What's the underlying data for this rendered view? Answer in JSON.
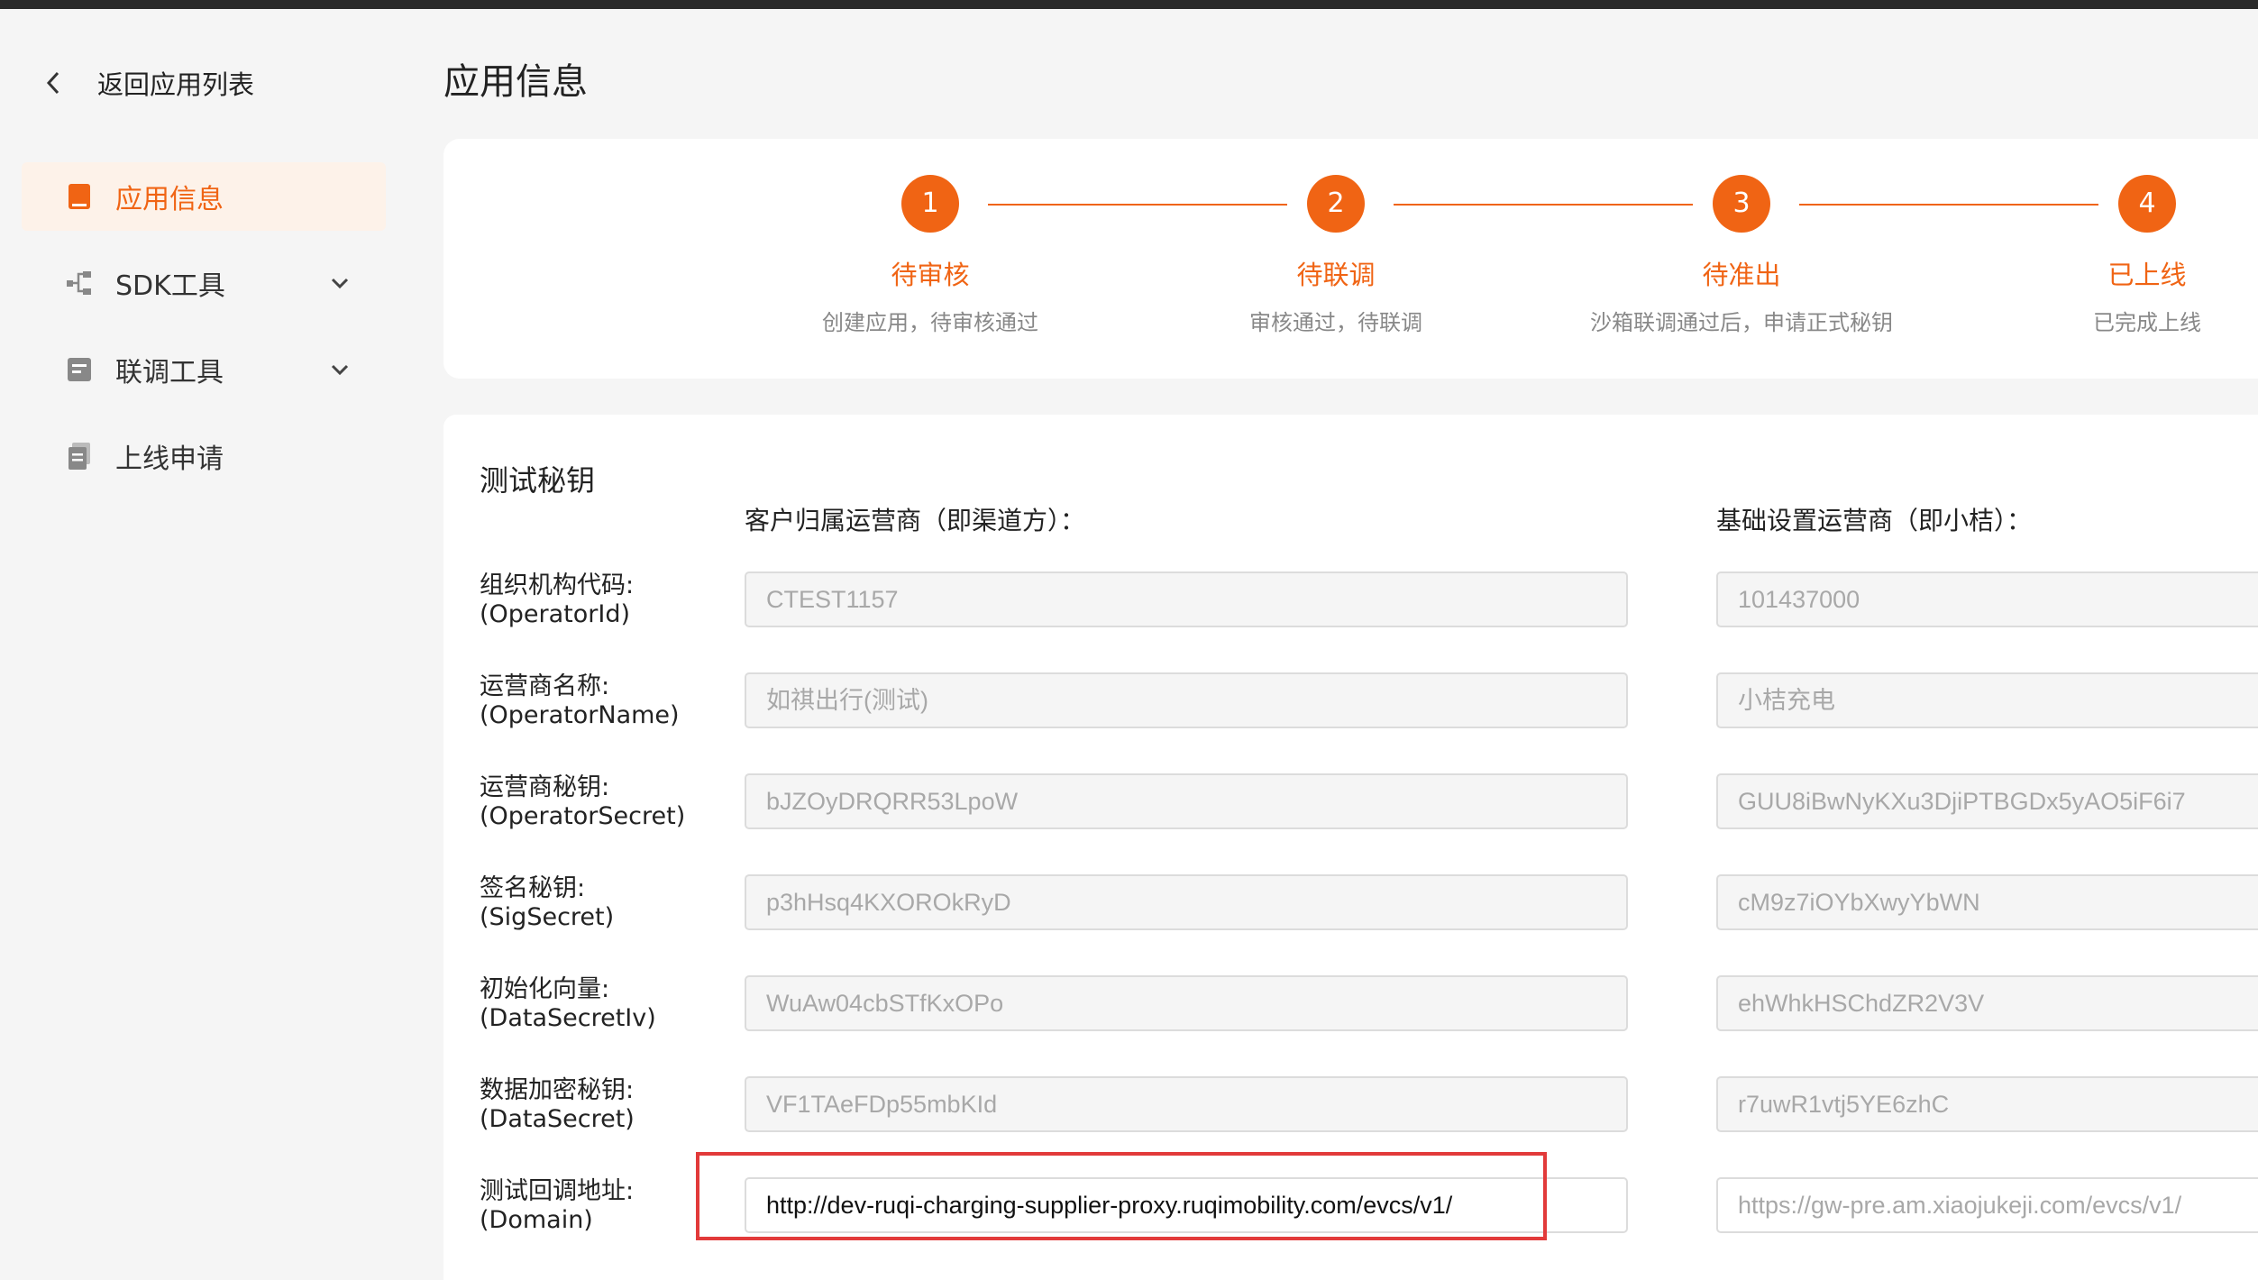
{
  "sidebar": {
    "back_label": "返回应用列表",
    "items": [
      {
        "label": "应用信息",
        "icon": "book-icon",
        "active": true,
        "expandable": false
      },
      {
        "label": "SDK工具",
        "icon": "tree-icon",
        "active": false,
        "expandable": true
      },
      {
        "label": "联调工具",
        "icon": "toolbox-icon",
        "active": false,
        "expandable": true
      },
      {
        "label": "上线申请",
        "icon": "document-icon",
        "active": false,
        "expandable": false
      }
    ]
  },
  "page_title": "应用信息",
  "steps": [
    {
      "num": "1",
      "title": "待审核",
      "desc": "创建应用，待审核通过"
    },
    {
      "num": "2",
      "title": "待联调",
      "desc": "审核通过，待联调"
    },
    {
      "num": "3",
      "title": "待准出",
      "desc": "沙箱联调通过后，申请正式秘钥"
    },
    {
      "num": "4",
      "title": "已上线",
      "desc": "已完成上线"
    }
  ],
  "secrets": {
    "title": "测试秘钥",
    "col1_header": "客户归属运营商（即渠道方）：",
    "col2_header": "基础设置运营商（即小桔）：",
    "rows": [
      {
        "label": "组织机构代码:",
        "sub": "(OperatorId)",
        "v1": "CTEST1157",
        "v2": "101437000"
      },
      {
        "label": "运营商名称:",
        "sub": "(OperatorName)",
        "v1": "如祺出行(测试)",
        "v2": "小桔充电"
      },
      {
        "label": "运营商秘钥:",
        "sub": "(OperatorSecret)",
        "v1": "bJZOyDRQRR53LpoW",
        "v2": "GUU8iBwNyKXu3DjiPTBGDx5yAO5iF6i7"
      },
      {
        "label": "签名秘钥:",
        "sub": "(SigSecret)",
        "v1": "p3hHsq4KXOROkRyD",
        "v2": "cM9z7iOYbXwyYbWN"
      },
      {
        "label": "初始化向量:",
        "sub": "(DataSecretIv)",
        "v1": "WuAw04cbSTfKxOPo",
        "v2": "ehWhkHSChdZR2V3V"
      },
      {
        "label": "数据加密秘钥:",
        "sub": "(DataSecret)",
        "v1": "VF1TAeFDp55mbKId",
        "v2": "r7uwR1vtj5YE6zhC"
      },
      {
        "label": "测试回调地址:",
        "sub": "(Domain)",
        "v1": "http://dev-ruqi-charging-supplier-proxy.ruqimobility.com/evcs/v1/",
        "v2": "https://gw-pre.am.xiaojukeji.com/evcs/v1/"
      }
    ]
  },
  "colors": {
    "accent": "#f06414",
    "highlight": "#e23a3a"
  }
}
